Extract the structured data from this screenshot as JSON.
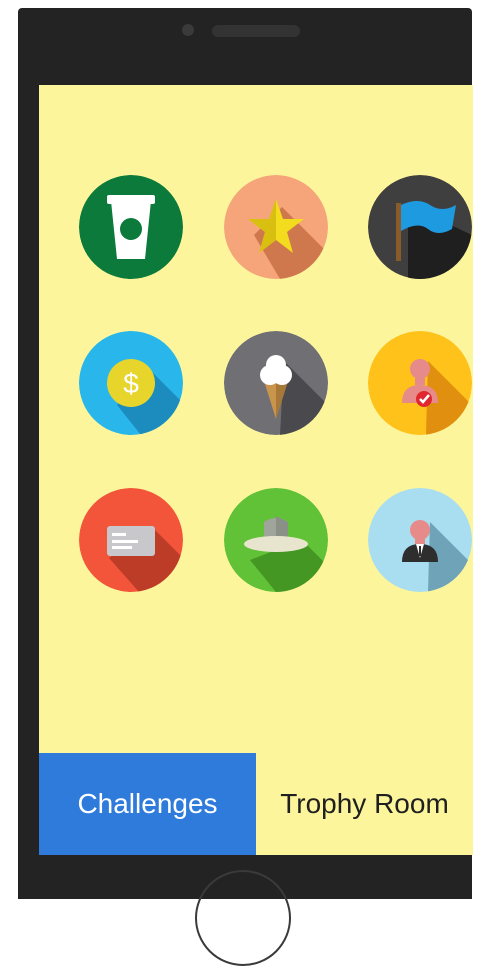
{
  "tabs": {
    "challenges_label": "Challenges",
    "trophy_room_label": "Trophy Room",
    "active": "challenges"
  },
  "badges": [
    {
      "name": "coffee-cup-icon",
      "color": "#0b7a3b"
    },
    {
      "name": "star-icon",
      "color": "#f6a47a"
    },
    {
      "name": "flag-icon",
      "color": "#3f3f3f"
    },
    {
      "name": "coin-dollar-icon",
      "color": "#29b6ea"
    },
    {
      "name": "ice-cream-icon",
      "color": "#6f6f74"
    },
    {
      "name": "person-check-icon",
      "color": "#ffc21a"
    },
    {
      "name": "credit-card-icon",
      "color": "#f2553a"
    },
    {
      "name": "cowboy-hat-icon",
      "color": "#62c237"
    },
    {
      "name": "businessman-icon",
      "color": "#a9def0"
    }
  ],
  "colors": {
    "screen_background": "#fdf59c",
    "tab_active": "#2e7bdc",
    "phone_body": "#232323"
  }
}
